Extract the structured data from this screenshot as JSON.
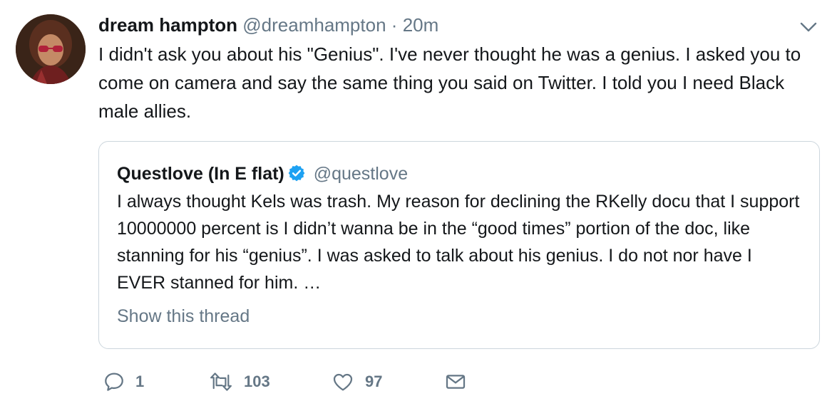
{
  "tweet": {
    "author_name": "dream hampton",
    "author_handle": "@dreamhampton",
    "separator": "·",
    "timestamp": "20m",
    "text": "I didn't ask you about his \"Genius\". I've never thought he was a genius. I asked you to come on camera and say the same thing you said on Twitter. I told you I need Black male allies."
  },
  "quoted_tweet": {
    "author_name": "Questlove (In E flat)",
    "author_handle": "@questlove",
    "verified": true,
    "text": "I always thought Kels was trash. My reason for declining the RKelly docu that I support 10000000 percent is I didn’t wanna be in the “good times” portion of the doc, like stanning for his “genius”. I was asked to talk about his genius. I do not nor have I EVER stanned for him. …",
    "show_thread_label": "Show this thread"
  },
  "actions": {
    "reply_count": "1",
    "retweet_count": "103",
    "like_count": "97"
  },
  "icons": {
    "caret": "chevron-down-icon",
    "verified": "verified-badge-icon",
    "reply": "reply-icon",
    "retweet": "retweet-icon",
    "like": "heart-icon",
    "dm": "envelope-icon"
  },
  "colors": {
    "text_primary": "#14171a",
    "text_secondary": "#657786",
    "border": "#ccd6dd",
    "verified_blue": "#1da1f2"
  }
}
